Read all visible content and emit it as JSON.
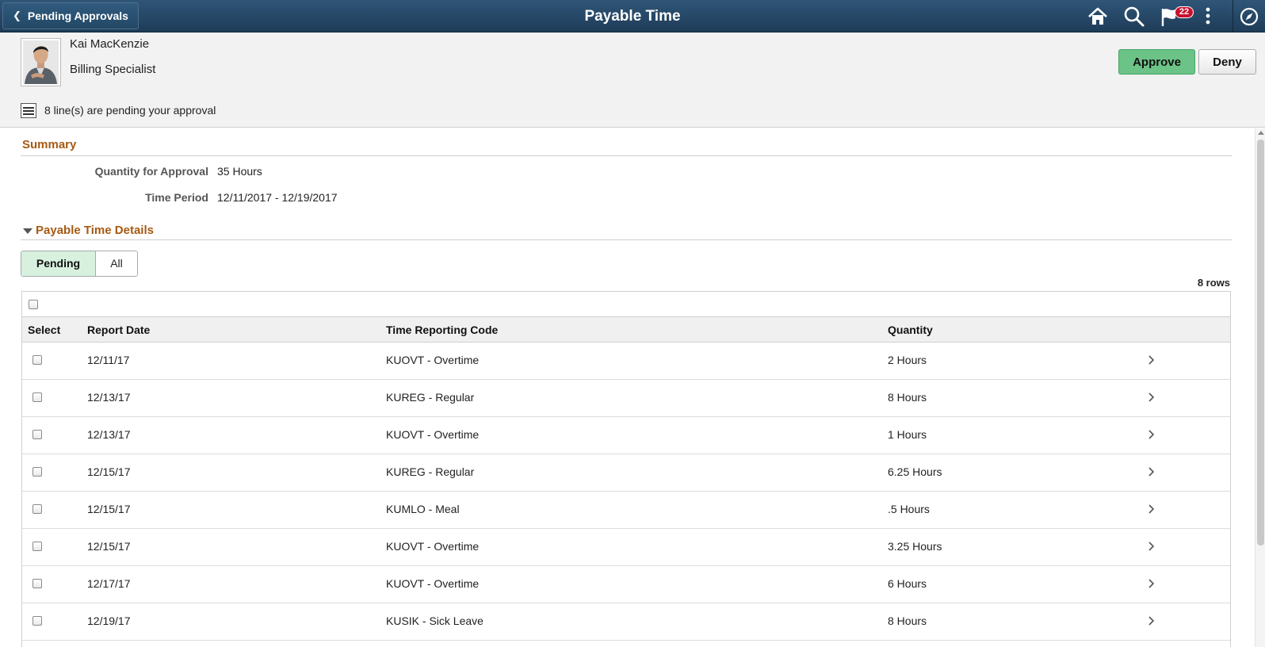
{
  "topbar": {
    "back_label": "Pending Approvals",
    "title": "Payable Time",
    "notification_count": "22",
    "icons": [
      "chevron-left-icon",
      "home-icon",
      "search-icon",
      "flag-icon",
      "kebab-menu-icon",
      "compass-icon"
    ]
  },
  "employee": {
    "name": "Kai MacKenzie",
    "title": "Billing Specialist"
  },
  "actions": {
    "approve_label": "Approve",
    "deny_label": "Deny"
  },
  "pending_message": "8 line(s) are pending your approval",
  "summary": {
    "title": "Summary",
    "quantity_label": "Quantity for Approval",
    "quantity_value": "35 Hours",
    "period_label": "Time Period",
    "period_value": "12/11/2017 - 12/19/2017"
  },
  "details": {
    "title": "Payable Time Details",
    "segments": [
      "Pending",
      "All"
    ],
    "rows_count": "8 rows",
    "columns": [
      "Select",
      "Report Date",
      "Time Reporting Code",
      "Quantity"
    ],
    "rows": [
      {
        "date": "12/11/17",
        "code": "KUOVT - Overtime",
        "qty": "2 Hours"
      },
      {
        "date": "12/13/17",
        "code": "KUREG - Regular",
        "qty": "8 Hours"
      },
      {
        "date": "12/13/17",
        "code": "KUOVT - Overtime",
        "qty": "1 Hours"
      },
      {
        "date": "12/15/17",
        "code": "KUREG - Regular",
        "qty": "6.25 Hours"
      },
      {
        "date": "12/15/17",
        "code": "KUMLO - Meal",
        "qty": ".5 Hours"
      },
      {
        "date": "12/15/17",
        "code": "KUOVT - Overtime",
        "qty": "3.25 Hours"
      },
      {
        "date": "12/17/17",
        "code": "KUOVT - Overtime",
        "qty": "6 Hours"
      },
      {
        "date": "12/19/17",
        "code": "KUSIK - Sick Leave",
        "qty": "8 Hours"
      }
    ]
  },
  "colors": {
    "topbar": "#234865",
    "section_title": "#a65a12",
    "approve": "#6cc387",
    "segment_selected": "#d7f1de",
    "badge": "#c8102e"
  }
}
